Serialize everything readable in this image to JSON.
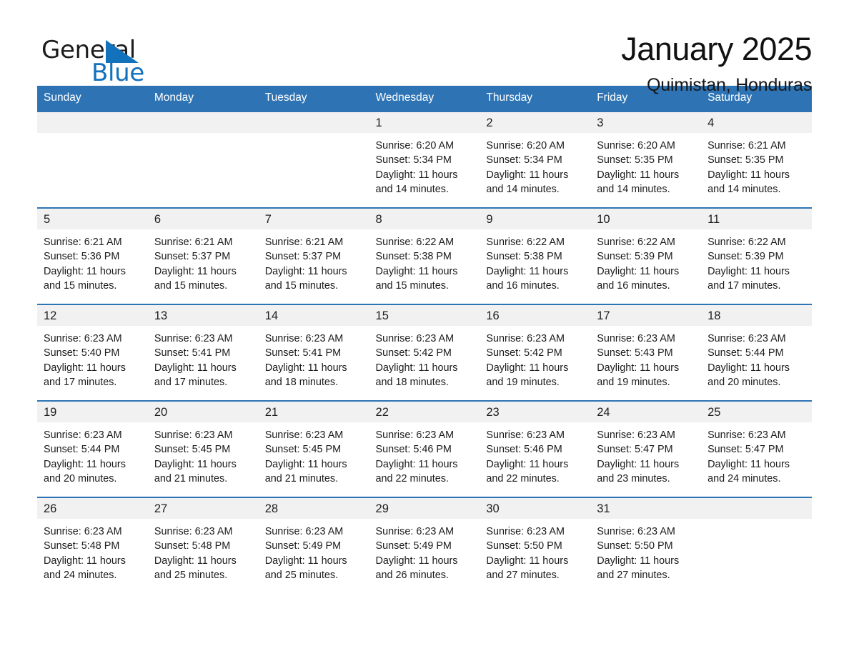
{
  "brand": {
    "name_part1": "General",
    "name_part2": "Blue",
    "flag_icon": "triangle-flag-icon"
  },
  "header": {
    "month_title": "January 2025",
    "location": "Quimistan, Honduras"
  },
  "theme": {
    "header_blue": "#2e74b5",
    "band_gray": "#f1f1f1",
    "brand_blue": "#1271bd",
    "text": "#1b1b1b"
  },
  "weekdays": [
    "Sunday",
    "Monday",
    "Tuesday",
    "Wednesday",
    "Thursday",
    "Friday",
    "Saturday"
  ],
  "weeks": [
    [
      {
        "day": "",
        "sunrise": "",
        "sunset": "",
        "daylight": "",
        "empty": true
      },
      {
        "day": "",
        "sunrise": "",
        "sunset": "",
        "daylight": "",
        "empty": true
      },
      {
        "day": "",
        "sunrise": "",
        "sunset": "",
        "daylight": "",
        "empty": true
      },
      {
        "day": "1",
        "sunrise": "Sunrise: 6:20 AM",
        "sunset": "Sunset: 5:34 PM",
        "daylight": "Daylight: 11 hours and 14 minutes."
      },
      {
        "day": "2",
        "sunrise": "Sunrise: 6:20 AM",
        "sunset": "Sunset: 5:34 PM",
        "daylight": "Daylight: 11 hours and 14 minutes."
      },
      {
        "day": "3",
        "sunrise": "Sunrise: 6:20 AM",
        "sunset": "Sunset: 5:35 PM",
        "daylight": "Daylight: 11 hours and 14 minutes."
      },
      {
        "day": "4",
        "sunrise": "Sunrise: 6:21 AM",
        "sunset": "Sunset: 5:35 PM",
        "daylight": "Daylight: 11 hours and 14 minutes."
      }
    ],
    [
      {
        "day": "5",
        "sunrise": "Sunrise: 6:21 AM",
        "sunset": "Sunset: 5:36 PM",
        "daylight": "Daylight: 11 hours and 15 minutes."
      },
      {
        "day": "6",
        "sunrise": "Sunrise: 6:21 AM",
        "sunset": "Sunset: 5:37 PM",
        "daylight": "Daylight: 11 hours and 15 minutes."
      },
      {
        "day": "7",
        "sunrise": "Sunrise: 6:21 AM",
        "sunset": "Sunset: 5:37 PM",
        "daylight": "Daylight: 11 hours and 15 minutes."
      },
      {
        "day": "8",
        "sunrise": "Sunrise: 6:22 AM",
        "sunset": "Sunset: 5:38 PM",
        "daylight": "Daylight: 11 hours and 15 minutes."
      },
      {
        "day": "9",
        "sunrise": "Sunrise: 6:22 AM",
        "sunset": "Sunset: 5:38 PM",
        "daylight": "Daylight: 11 hours and 16 minutes."
      },
      {
        "day": "10",
        "sunrise": "Sunrise: 6:22 AM",
        "sunset": "Sunset: 5:39 PM",
        "daylight": "Daylight: 11 hours and 16 minutes."
      },
      {
        "day": "11",
        "sunrise": "Sunrise: 6:22 AM",
        "sunset": "Sunset: 5:39 PM",
        "daylight": "Daylight: 11 hours and 17 minutes."
      }
    ],
    [
      {
        "day": "12",
        "sunrise": "Sunrise: 6:23 AM",
        "sunset": "Sunset: 5:40 PM",
        "daylight": "Daylight: 11 hours and 17 minutes."
      },
      {
        "day": "13",
        "sunrise": "Sunrise: 6:23 AM",
        "sunset": "Sunset: 5:41 PM",
        "daylight": "Daylight: 11 hours and 17 minutes."
      },
      {
        "day": "14",
        "sunrise": "Sunrise: 6:23 AM",
        "sunset": "Sunset: 5:41 PM",
        "daylight": "Daylight: 11 hours and 18 minutes."
      },
      {
        "day": "15",
        "sunrise": "Sunrise: 6:23 AM",
        "sunset": "Sunset: 5:42 PM",
        "daylight": "Daylight: 11 hours and 18 minutes."
      },
      {
        "day": "16",
        "sunrise": "Sunrise: 6:23 AM",
        "sunset": "Sunset: 5:42 PM",
        "daylight": "Daylight: 11 hours and 19 minutes."
      },
      {
        "day": "17",
        "sunrise": "Sunrise: 6:23 AM",
        "sunset": "Sunset: 5:43 PM",
        "daylight": "Daylight: 11 hours and 19 minutes."
      },
      {
        "day": "18",
        "sunrise": "Sunrise: 6:23 AM",
        "sunset": "Sunset: 5:44 PM",
        "daylight": "Daylight: 11 hours and 20 minutes."
      }
    ],
    [
      {
        "day": "19",
        "sunrise": "Sunrise: 6:23 AM",
        "sunset": "Sunset: 5:44 PM",
        "daylight": "Daylight: 11 hours and 20 minutes."
      },
      {
        "day": "20",
        "sunrise": "Sunrise: 6:23 AM",
        "sunset": "Sunset: 5:45 PM",
        "daylight": "Daylight: 11 hours and 21 minutes."
      },
      {
        "day": "21",
        "sunrise": "Sunrise: 6:23 AM",
        "sunset": "Sunset: 5:45 PM",
        "daylight": "Daylight: 11 hours and 21 minutes."
      },
      {
        "day": "22",
        "sunrise": "Sunrise: 6:23 AM",
        "sunset": "Sunset: 5:46 PM",
        "daylight": "Daylight: 11 hours and 22 minutes."
      },
      {
        "day": "23",
        "sunrise": "Sunrise: 6:23 AM",
        "sunset": "Sunset: 5:46 PM",
        "daylight": "Daylight: 11 hours and 22 minutes."
      },
      {
        "day": "24",
        "sunrise": "Sunrise: 6:23 AM",
        "sunset": "Sunset: 5:47 PM",
        "daylight": "Daylight: 11 hours and 23 minutes."
      },
      {
        "day": "25",
        "sunrise": "Sunrise: 6:23 AM",
        "sunset": "Sunset: 5:47 PM",
        "daylight": "Daylight: 11 hours and 24 minutes."
      }
    ],
    [
      {
        "day": "26",
        "sunrise": "Sunrise: 6:23 AM",
        "sunset": "Sunset: 5:48 PM",
        "daylight": "Daylight: 11 hours and 24 minutes."
      },
      {
        "day": "27",
        "sunrise": "Sunrise: 6:23 AM",
        "sunset": "Sunset: 5:48 PM",
        "daylight": "Daylight: 11 hours and 25 minutes."
      },
      {
        "day": "28",
        "sunrise": "Sunrise: 6:23 AM",
        "sunset": "Sunset: 5:49 PM",
        "daylight": "Daylight: 11 hours and 25 minutes."
      },
      {
        "day": "29",
        "sunrise": "Sunrise: 6:23 AM",
        "sunset": "Sunset: 5:49 PM",
        "daylight": "Daylight: 11 hours and 26 minutes."
      },
      {
        "day": "30",
        "sunrise": "Sunrise: 6:23 AM",
        "sunset": "Sunset: 5:50 PM",
        "daylight": "Daylight: 11 hours and 27 minutes."
      },
      {
        "day": "31",
        "sunrise": "Sunrise: 6:23 AM",
        "sunset": "Sunset: 5:50 PM",
        "daylight": "Daylight: 11 hours and 27 minutes."
      },
      {
        "day": "",
        "sunrise": "",
        "sunset": "",
        "daylight": "",
        "empty": true
      }
    ]
  ]
}
